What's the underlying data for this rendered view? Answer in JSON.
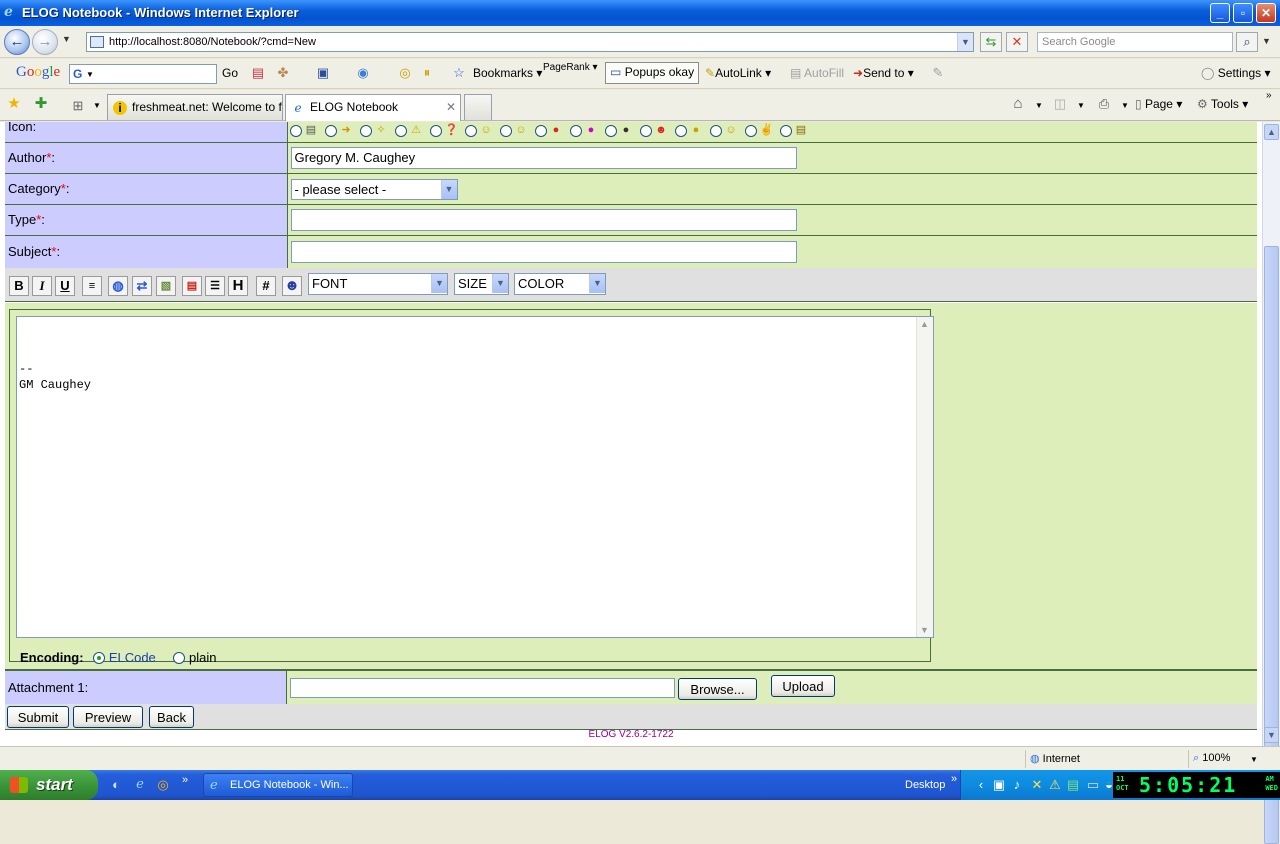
{
  "window": {
    "title": "ELOG Notebook - Windows Internet Explorer"
  },
  "address_bar": {
    "url": "http://localhost:8080/Notebook/?cmd=New",
    "search_placeholder": "Search Google"
  },
  "google_toolbar": {
    "logo": "Google",
    "go_label": "Go",
    "bookmarks_label": "Bookmarks",
    "pagerank_label": "PageRank",
    "popups_label": "Popups okay",
    "autolink_label": "AutoLink",
    "autofill_label": "AutoFill",
    "sendto_label": "Send to",
    "settings_label": "Settings"
  },
  "tabs": [
    {
      "label": "freshmeat.net: Welcome to f...",
      "active": false
    },
    {
      "label": "ELOG Notebook",
      "active": true
    }
  ],
  "command_bar": {
    "page_label": "Page",
    "tools_label": "Tools"
  },
  "form": {
    "icon_label": "Icon:",
    "author_label": "Author",
    "author_value": "Gregory M. Caughey",
    "category_label": "Category",
    "category_value": "- please select -",
    "type_label": "Type",
    "type_value": "",
    "subject_label": "Subject",
    "subject_value": "",
    "required_marker": "*",
    "colon": ":"
  },
  "editor": {
    "toolbar": {
      "bold": "B",
      "italic": "I",
      "underline": "U",
      "heading": "H",
      "hash": "#",
      "font_select": "FONT",
      "size_select": "SIZE",
      "color_select": "COLOR"
    },
    "text": "--\nGM Caughey",
    "encoding_label": "Encoding",
    "encoding_options": [
      "ELCode",
      "plain"
    ],
    "encoding_selected": "ELCode"
  },
  "attachment": {
    "label": "Attachment 1:",
    "browse_label": "Browse...",
    "upload_label": "Upload"
  },
  "buttons": {
    "submit": "Submit",
    "preview": "Preview",
    "back": "Back"
  },
  "footer": {
    "version": "ELOG V2.6.2-1722"
  },
  "status_bar": {
    "zone": "Internet",
    "zoom": "100%"
  },
  "taskbar": {
    "start_label": "start",
    "task_label": "ELOG Notebook - Win...",
    "desktop_label": "Desktop",
    "clock": "5:05:21",
    "date_day": "11",
    "date_month": "OCT",
    "weekday": "WED",
    "ampm": "AM"
  },
  "colors": {
    "label_bg": "#ccccff",
    "value_bg": "#ddeebb",
    "border": "#476e3d",
    "required": "#ee0000",
    "footer": "#990099",
    "clock": "#00ff66"
  }
}
